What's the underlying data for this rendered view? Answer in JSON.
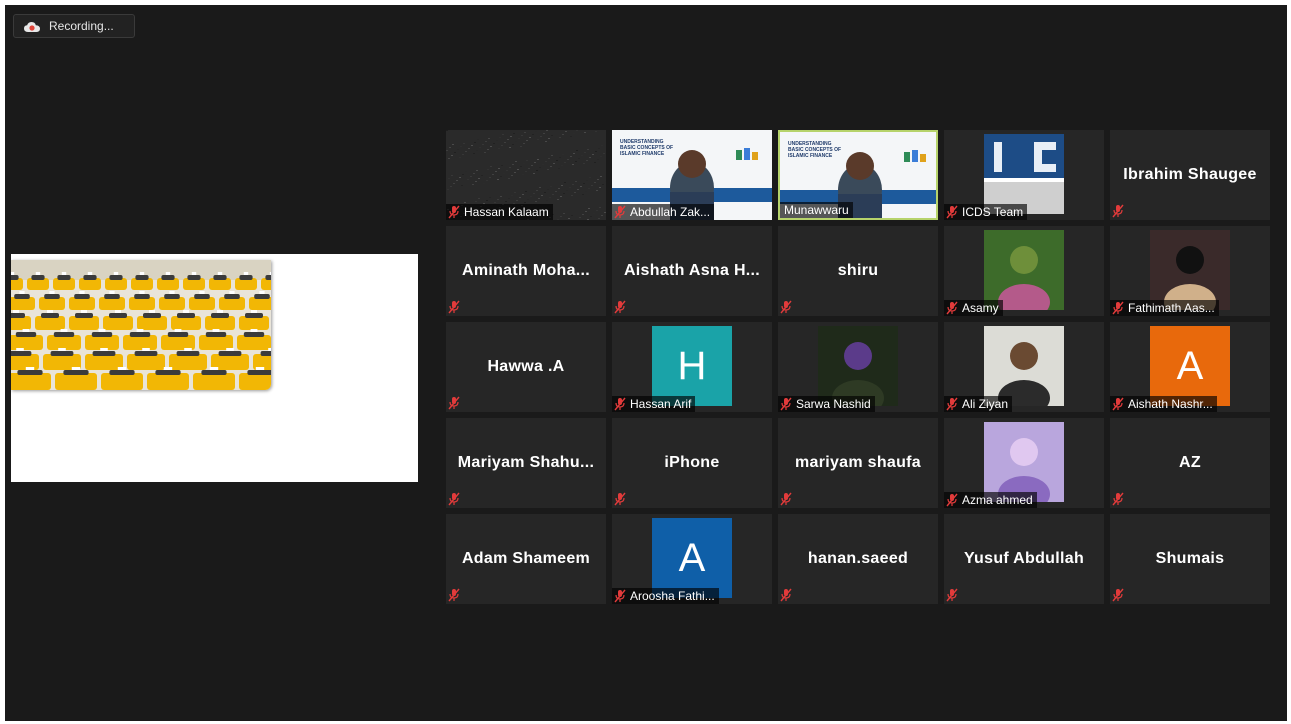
{
  "recording": {
    "label": "Recording..."
  },
  "participants": [
    {
      "name": "Hassan Kalaam",
      "kind": "noise"
    },
    {
      "name": "Abdullah Zak...",
      "kind": "video-slide"
    },
    {
      "name": "Munawwaru",
      "kind": "video-slide",
      "active": true
    },
    {
      "name": "ICDS Team",
      "kind": "logo"
    },
    {
      "name": "Ibrahim Shaugee",
      "kind": "name-only"
    },
    {
      "name": "Aminath  Moha...",
      "kind": "name-only"
    },
    {
      "name": "Aishath  Asna  H...",
      "kind": "name-only"
    },
    {
      "name": "shiru",
      "kind": "name-only"
    },
    {
      "name": "Asamy",
      "kind": "photo"
    },
    {
      "name": "Fathimath Aas...",
      "kind": "photo"
    },
    {
      "name": "Hawwa .A",
      "kind": "name-only"
    },
    {
      "name": "Hassan Arif",
      "kind": "avatar",
      "initial": "H",
      "color": "#1aa3a8"
    },
    {
      "name": "Sarwa Nashid",
      "kind": "photo"
    },
    {
      "name": "Ali Ziyan",
      "kind": "photo"
    },
    {
      "name": "Aishath Nashr...",
      "kind": "avatar",
      "initial": "A",
      "color": "#e8690c"
    },
    {
      "name": "Mariyam  Shahu...",
      "kind": "name-only"
    },
    {
      "name": "iPhone",
      "kind": "name-only"
    },
    {
      "name": "mariyam shaufa",
      "kind": "name-only"
    },
    {
      "name": "Azma ahmed",
      "kind": "photo"
    },
    {
      "name": "AZ",
      "kind": "name-only"
    },
    {
      "name": "Adam Shameem",
      "kind": "name-only"
    },
    {
      "name": "Aroosha Fathi...",
      "kind": "avatar",
      "initial": "A",
      "color": "#0f5fa8"
    },
    {
      "name": "hanan.saeed",
      "kind": "name-only"
    },
    {
      "name": "Yusuf Abdullah",
      "kind": "name-only"
    },
    {
      "name": "Shumais",
      "kind": "name-only"
    }
  ],
  "slide": {
    "title": "UNDERSTANDING BASIC CONCEPTS OF ISLAMIC FINANCE"
  },
  "colors": {
    "active_border": "#b6d36b",
    "mute": "#e23b3b"
  }
}
